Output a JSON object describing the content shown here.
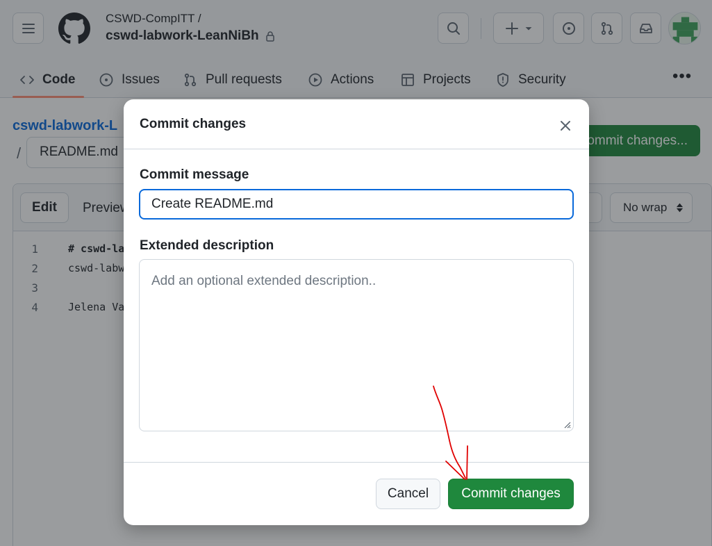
{
  "header": {
    "owner": "CSWD-CompITT /",
    "repo": "cswd-labwork-LeanNiBh"
  },
  "tabs": [
    {
      "label": "Code",
      "icon": "code-icon"
    },
    {
      "label": "Issues",
      "icon": "issue-opened-icon"
    },
    {
      "label": "Pull requests",
      "icon": "git-pull-request-icon"
    },
    {
      "label": "Actions",
      "icon": "play-icon"
    },
    {
      "label": "Projects",
      "icon": "table-icon"
    },
    {
      "label": "Security",
      "icon": "shield-icon"
    }
  ],
  "page": {
    "breadcrumb_repo": "cswd-labwork-L",
    "breadcrumb_sep": "/",
    "file_name": "README.md",
    "commit_button": "Commit changes..."
  },
  "editor": {
    "edit_tab": "Edit",
    "preview_tab": "Preview",
    "wrap_select": "No wrap",
    "lines": [
      {
        "num": "1",
        "text": "# cswd-la"
      },
      {
        "num": "2",
        "text": "cswd-labw"
      },
      {
        "num": "3",
        "text": ""
      },
      {
        "num": "4",
        "text": "Jelena Va"
      }
    ]
  },
  "dialog": {
    "title": "Commit changes",
    "message_label": "Commit message",
    "message_value": "Create README.md",
    "description_label": "Extended description",
    "description_placeholder": "Add an optional extended description..",
    "cancel": "Cancel",
    "submit": "Commit changes"
  },
  "colors": {
    "primary_green": "#1f883d",
    "focus_blue": "#0969da",
    "annotation_red": "#e00000"
  }
}
